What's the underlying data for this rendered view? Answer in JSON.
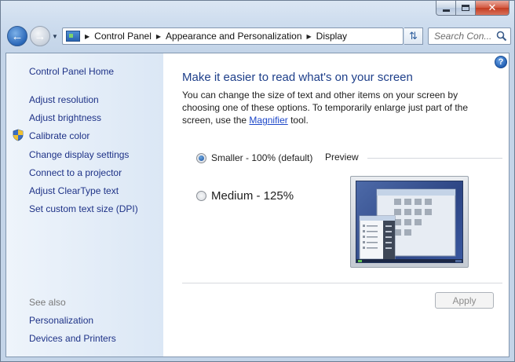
{
  "window": {
    "caption_buttons": {
      "minimize": "minimize",
      "maximize": "maximize",
      "close": "✕"
    }
  },
  "navbar": {
    "breadcrumbs": [
      "Control Panel",
      "Appearance and Personalization",
      "Display"
    ],
    "search_placeholder": "Search Con..."
  },
  "sidebar": {
    "home": "Control Panel Home",
    "links": [
      "Adjust resolution",
      "Adjust brightness",
      "Calibrate color",
      "Change display settings",
      "Connect to a projector",
      "Adjust ClearType text",
      "Set custom text size (DPI)"
    ],
    "see_also_heading": "See also",
    "see_also": [
      "Personalization",
      "Devices and Printers"
    ]
  },
  "main": {
    "help": "?",
    "title": "Make it easier to read what's on your screen",
    "intro_text": "You can change the size of text and other items on your screen by choosing one of these options. To temporarily enlarge just part of the screen, use the",
    "intro_link": "Magnifier",
    "intro_suffix": " tool.",
    "options": [
      {
        "label": "Smaller - 100% (default)",
        "selected": true
      },
      {
        "label": "Medium - 125%",
        "selected": false
      }
    ],
    "preview_label": "Preview",
    "apply_label": "Apply",
    "apply_enabled": false
  }
}
